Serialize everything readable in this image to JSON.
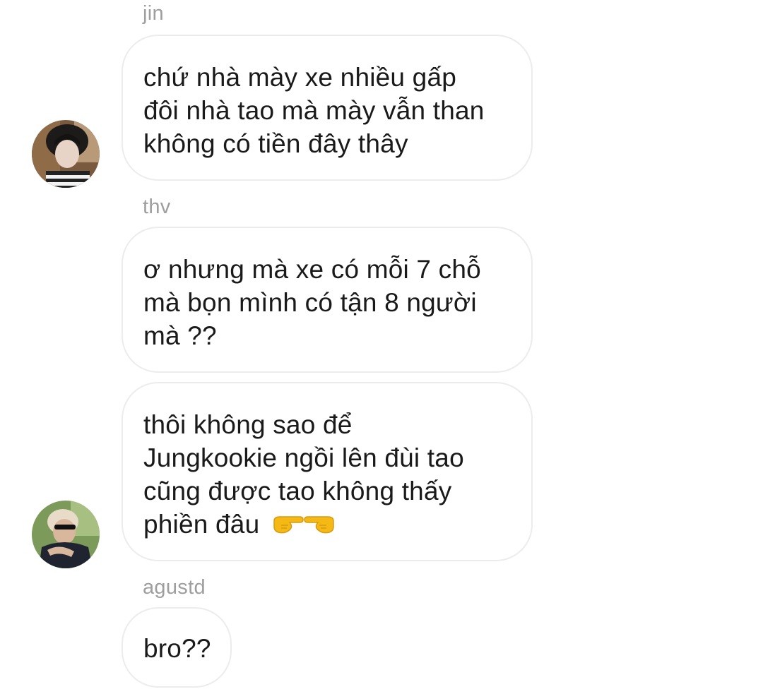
{
  "messages": [
    {
      "sender": "jin",
      "lines": [
        "chứ nhà mày xe nhiều gấp",
        "đôi nhà tao mà mày vẫn than",
        "không có tiền đây thây"
      ]
    },
    {
      "sender": "thv",
      "lines": [
        "ơ nhưng mà xe có mỗi 7 chỗ",
        "mà bọn mình có tận 8 người",
        "mà ??"
      ]
    },
    {
      "sender": "",
      "lines": [
        "thôi không sao để",
        "Jungkookie ngồi lên đùi tao",
        "cũng được tao không thấy",
        "phiền đâu"
      ],
      "emoji": [
        "pointing-right-hand-icon",
        "pointing-left-hand-icon"
      ]
    },
    {
      "sender": "agustd",
      "lines": [
        "bro??"
      ]
    }
  ],
  "avatars": [
    "avatar-jin",
    "avatar-thv"
  ],
  "colors": {
    "background": "#ffffff",
    "bubble_border": "#ececec",
    "sender_name": "#9e9e9e",
    "text": "#1a1a1a",
    "emoji": "#f5b916"
  }
}
